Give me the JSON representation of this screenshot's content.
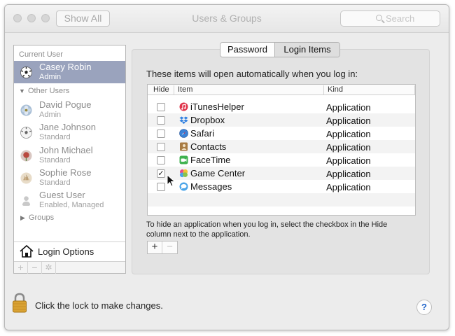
{
  "window": {
    "title": "Users & Groups",
    "show_all_label": "Show All",
    "search_placeholder": "Search"
  },
  "sidebar": {
    "current_user_header": "Current User",
    "current_user": {
      "name": "Casey Robin",
      "role": "Admin"
    },
    "other_users_header": "Other Users",
    "other_users": [
      {
        "name": "David Pogue",
        "role": "Admin"
      },
      {
        "name": "Jane Johnson",
        "role": "Standard"
      },
      {
        "name": "John Michael",
        "role": "Standard"
      },
      {
        "name": "Sophie Rose",
        "role": "Standard"
      },
      {
        "name": "Guest User",
        "role": "Enabled, Managed"
      }
    ],
    "groups_label": "Groups",
    "login_options_label": "Login Options",
    "toolbar": {
      "add": "+",
      "remove": "−"
    }
  },
  "tabs": [
    {
      "label": "Password",
      "selected": false
    },
    {
      "label": "Login Items",
      "selected": true
    }
  ],
  "login_items": {
    "intro": "These items will open automatically when you log in:",
    "columns": {
      "hide": "Hide",
      "item": "Item",
      "kind": "Kind"
    },
    "rows": [
      {
        "hide": false,
        "name": "iTunesHelper",
        "kind": "Application",
        "icon": "itunes-icon"
      },
      {
        "hide": false,
        "name": "Dropbox",
        "kind": "Application",
        "icon": "dropbox-icon"
      },
      {
        "hide": false,
        "name": "Safari",
        "kind": "Application",
        "icon": "safari-icon"
      },
      {
        "hide": false,
        "name": "Contacts",
        "kind": "Application",
        "icon": "contacts-icon"
      },
      {
        "hide": false,
        "name": "FaceTime",
        "kind": "Application",
        "icon": "facetime-icon"
      },
      {
        "hide": true,
        "name": "Game Center",
        "kind": "Application",
        "icon": "game-center-icon"
      },
      {
        "hide": false,
        "name": "Messages",
        "kind": "Application",
        "icon": "messages-icon"
      }
    ],
    "checkmark": "✓",
    "hint": "To hide an application when you log in, select the checkbox in the Hide column next to the application.",
    "add_label": "+",
    "remove_label": "−"
  },
  "footer": {
    "lock_text": "Click the lock to make changes.",
    "help_label": "?"
  }
}
